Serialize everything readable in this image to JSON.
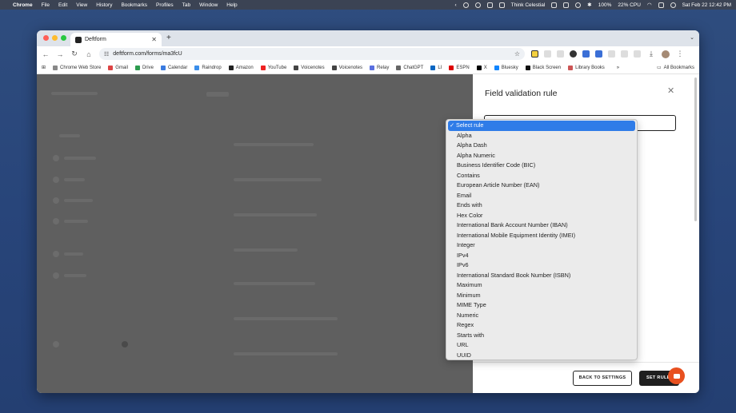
{
  "menubar": {
    "app": "Chrome",
    "items": [
      "File",
      "Edit",
      "View",
      "History",
      "Bookmarks",
      "Profiles",
      "Tab",
      "Window",
      "Help"
    ],
    "right_text": "Think Celestial",
    "battery": "100%",
    "cpu": "22% CPU",
    "clock": "Sat Feb 22  12:42 PM"
  },
  "browser": {
    "tab_title": "Deftform",
    "url": "deftform.com/forms/ma3fcU",
    "bookmarks": [
      "Chrome Web Store",
      "Gmail",
      "Drive",
      "Calendar",
      "Raindrop",
      "Amazon",
      "YouTube",
      "Voicenotes",
      "Voicenotes",
      "Relay",
      "ChatGPT",
      "LI",
      "ESPN",
      "X",
      "Bluesky",
      "Black Screen",
      "Library Books"
    ],
    "bookmarks_more": "»",
    "all_bookmarks": "All Bookmarks"
  },
  "panel": {
    "title": "Field validation rule",
    "close_icon": "close-icon",
    "back_button": "BACK TO SETTINGS",
    "set_button": "SET RULE"
  },
  "dropdown": {
    "selected": "Select rule",
    "check": "✓",
    "options": [
      "Alpha",
      "Alpha Dash",
      "Alpha Numeric",
      "Business Identifier Code (BIC)",
      "Contains",
      "European Article Number (EAN)",
      "Email",
      "Ends with",
      "Hex Color",
      "International Bank Account Number (IBAN)",
      "International Mobile Equipment Identity (IMEI)",
      "Integer",
      "IPv4",
      "IPv6",
      "International Standard Book Number (ISBN)",
      "Maximum",
      "Minimum",
      "MIME Type",
      "Numeric",
      "Regex",
      "Starts with",
      "URL",
      "UUID"
    ]
  },
  "colors": {
    "accent_select": "#2f7ce8",
    "chat_bubble": "#e8501f",
    "desktop": "#2b4a7c"
  }
}
